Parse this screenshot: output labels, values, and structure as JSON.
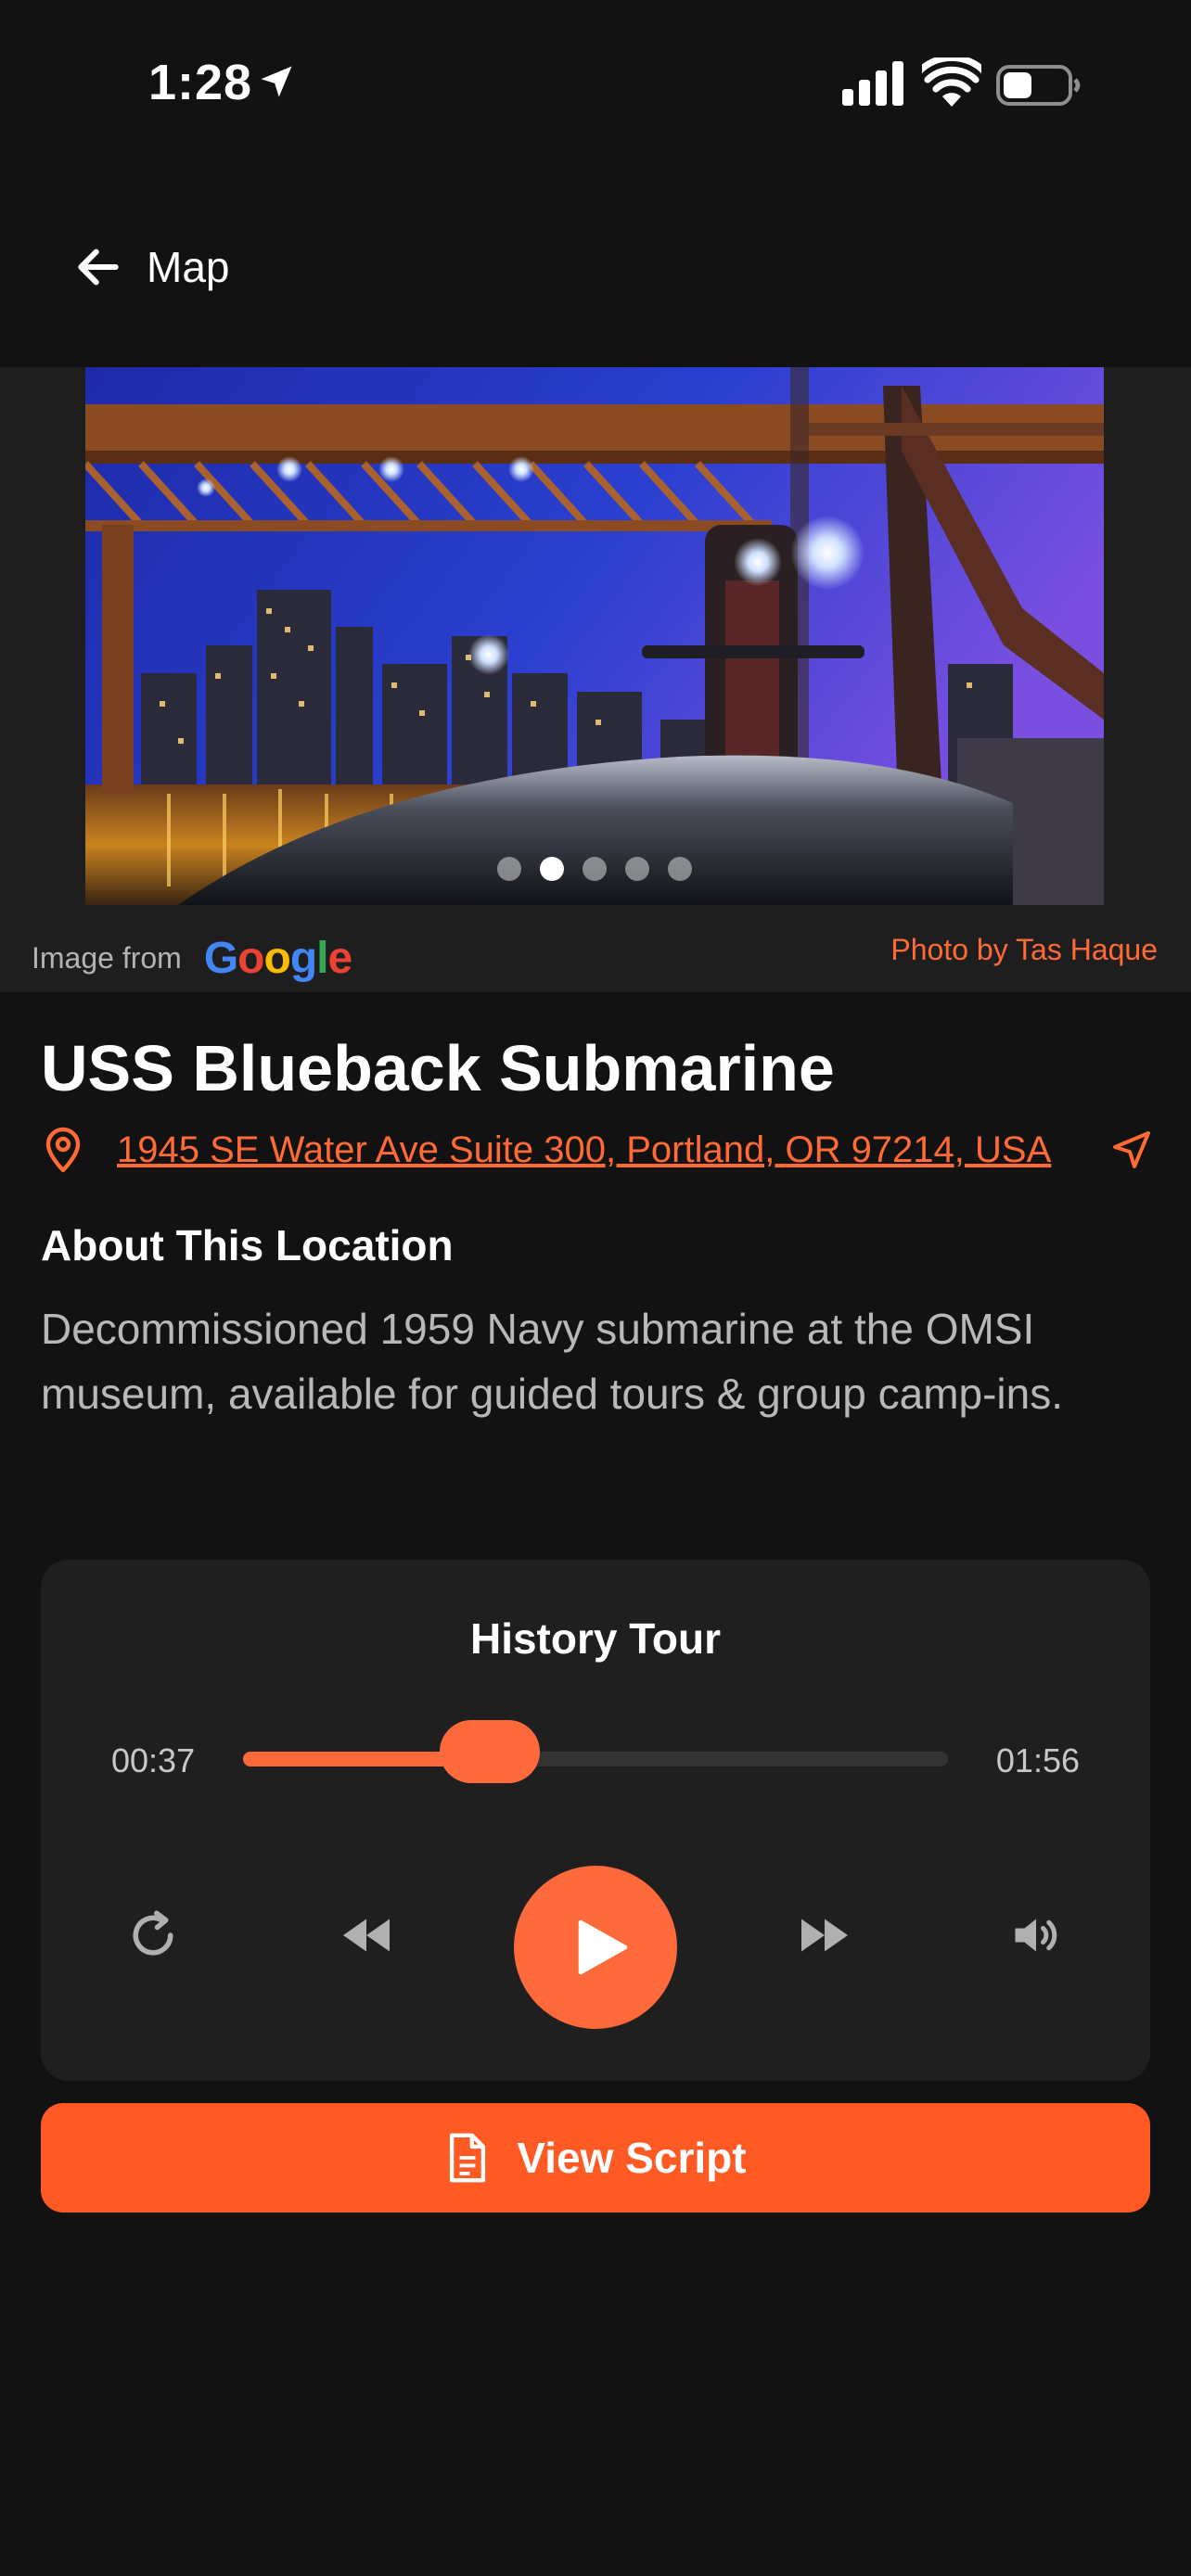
{
  "status_bar": {
    "time": "1:28"
  },
  "nav": {
    "back_label": "Map"
  },
  "image": {
    "source_label": "Image from",
    "source_brand": "Google",
    "credit": "Photo by Tas Haque",
    "dot_count": 5,
    "active_dot": 2
  },
  "location": {
    "title": "USS Blueback Submarine",
    "address": "1945 SE Water Ave Suite 300, Portland, OR 97214, USA",
    "about_heading": "About This Location",
    "about_text": "Decommissioned 1959 Navy submarine at the OMSI museum, available for guided tours & group camp-ins."
  },
  "player": {
    "title": "History Tour",
    "current_time": "00:37",
    "total_time": "01:56",
    "progress": 0.35,
    "controls": [
      "replay-icon",
      "rewind-icon",
      "play-icon",
      "fast-forward-icon",
      "volume-icon"
    ]
  },
  "script_button": {
    "label": "View Script"
  },
  "colors": {
    "accent": "#ff6a3d",
    "button": "#ff5a24",
    "background": "#121212",
    "card": "#1f1f1f"
  }
}
